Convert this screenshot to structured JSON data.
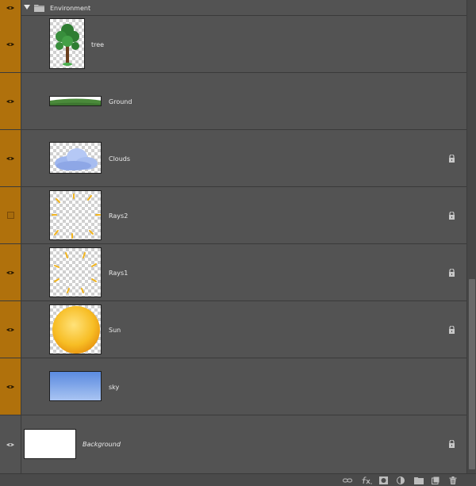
{
  "panel": "Layers",
  "group": {
    "name": "Environment",
    "expanded": true,
    "visible": true
  },
  "layers": [
    {
      "name": "tree",
      "visible": true,
      "locked": false,
      "thumbnail": "tree"
    },
    {
      "name": "Ground",
      "visible": true,
      "locked": false,
      "thumbnail": "ground"
    },
    {
      "name": "Clouds",
      "visible": true,
      "locked": true,
      "thumbnail": "clouds"
    },
    {
      "name": "Rays2",
      "visible": false,
      "locked": true,
      "thumbnail": "rays"
    },
    {
      "name": "Rays1",
      "visible": true,
      "locked": true,
      "thumbnail": "rays"
    },
    {
      "name": "Sun",
      "visible": true,
      "locked": true,
      "thumbnail": "sun"
    },
    {
      "name": "sky",
      "visible": true,
      "locked": false,
      "thumbnail": "sky"
    }
  ],
  "background_layer": {
    "name": "Background",
    "visible": true,
    "locked": true
  },
  "bottom_toolbar": [
    "link-layers-icon",
    "fx-icon",
    "layer-mask-icon",
    "adjustment-layer-icon",
    "new-group-icon",
    "new-layer-icon",
    "trash-icon"
  ],
  "colors": {
    "panel_bg": "#535353",
    "visibility_column_orange": "#b0710c",
    "row_divider": "#3a3a3a"
  }
}
